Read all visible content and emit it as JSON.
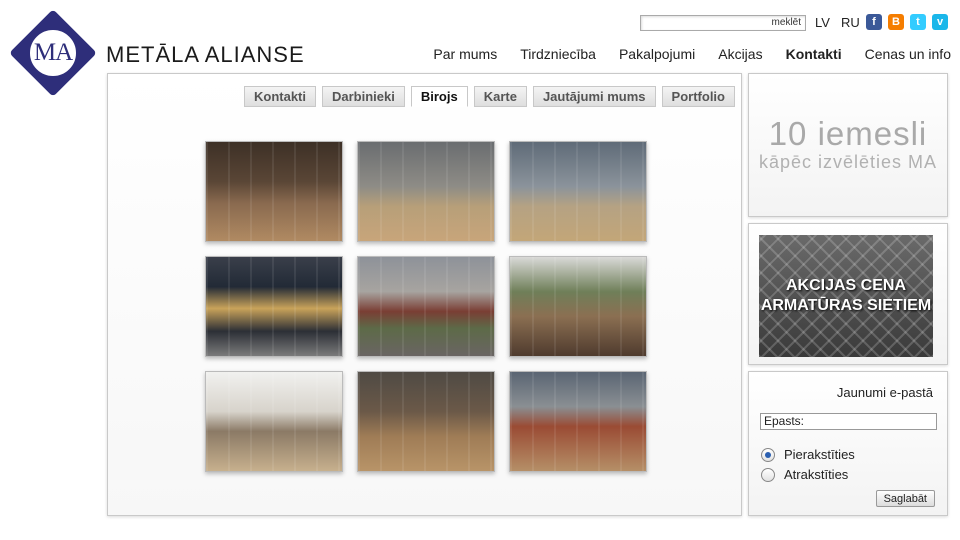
{
  "brand": {
    "logo_text": "MA",
    "name": "METĀLA ALIANSE"
  },
  "top": {
    "search": {
      "button": "meklēt",
      "value": ""
    },
    "languages": [
      "LV",
      "RU"
    ],
    "social": [
      {
        "name": "facebook-icon",
        "glyph": "f",
        "color": "#3b5998"
      },
      {
        "name": "blogger-icon",
        "glyph": "B",
        "color": "#f57d00"
      },
      {
        "name": "twitter-icon",
        "glyph": "t",
        "color": "#33ccff"
      },
      {
        "name": "vimeo-icon",
        "glyph": "v",
        "color": "#1ab7ea"
      }
    ]
  },
  "nav": [
    "Par mums",
    "Tirdzniecība",
    "Pakalpojumi",
    "Akcijas",
    "Kontakti",
    "Cenas un info"
  ],
  "nav_active": "Kontakti",
  "tabs": [
    "Kontakti",
    "Darbinieki",
    "Birojs",
    "Karte",
    "Jautājumi mums",
    "Portfolio"
  ],
  "tab_active": "Birojs",
  "gallery": [
    {
      "name": "photo-showroom-stairs"
    },
    {
      "name": "photo-showroom-displays"
    },
    {
      "name": "photo-showroom-window"
    },
    {
      "name": "photo-office-exterior"
    },
    {
      "name": "photo-roofing-samples"
    },
    {
      "name": "photo-house-display"
    },
    {
      "name": "photo-office-desk"
    },
    {
      "name": "photo-showroom-racks"
    },
    {
      "name": "photo-showroom-corner"
    }
  ],
  "sidebar": {
    "reasons": {
      "big": "10 iemesli",
      "small": "kāpēc izvēlēties MA"
    },
    "promo": {
      "line1": "AKCIJAS CENA",
      "line2": "ARMATŪRAS SIETIEM"
    },
    "newsletter": {
      "title": "Jaunumi e-pastā",
      "email_label": "Epasts:",
      "subscribe": "Pierakstīties",
      "unsubscribe": "Atrakstīties",
      "save": "Saglabāt"
    }
  }
}
